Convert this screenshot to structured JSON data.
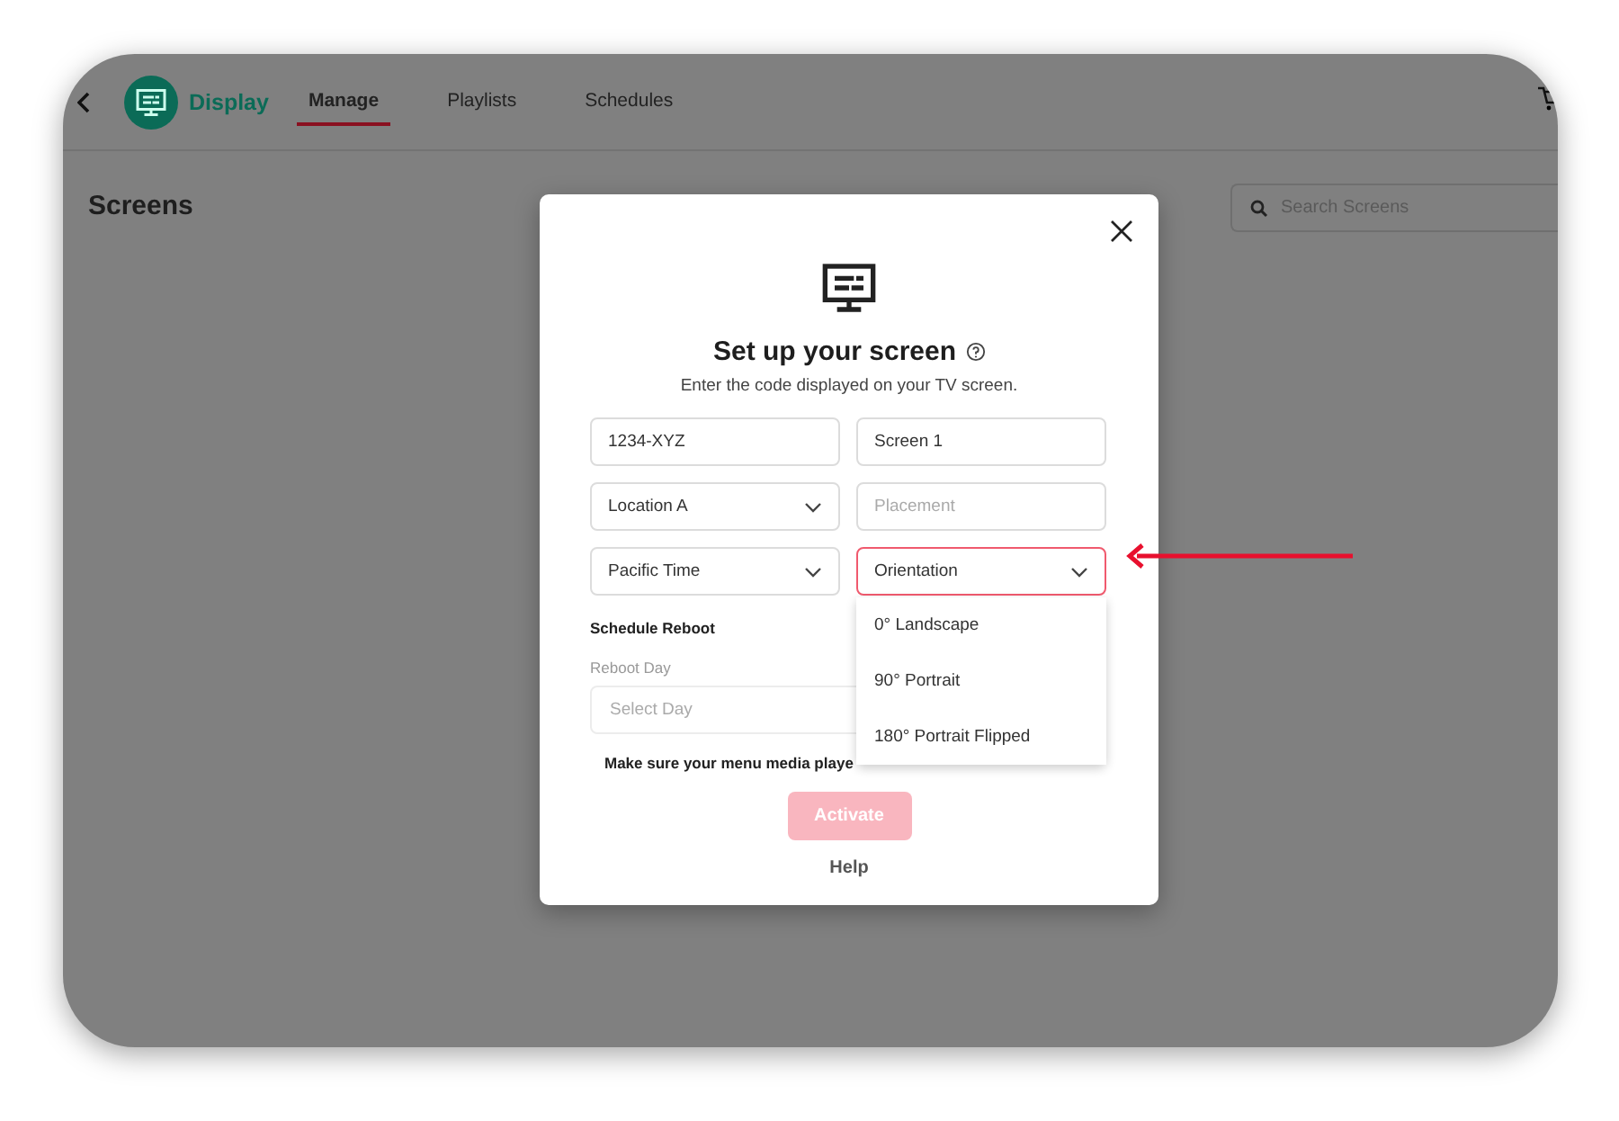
{
  "app_bar": {
    "brand": "Display",
    "tabs": [
      {
        "label": "Manage",
        "selected": true
      },
      {
        "label": "Playlists",
        "selected": false
      },
      {
        "label": "Schedules",
        "selected": false
      }
    ]
  },
  "page": {
    "title": "Screens",
    "search": {
      "placeholder": "Search Screens"
    }
  },
  "dialog": {
    "title": "Set up your screen",
    "subtitle": "Enter the code displayed on your TV screen.",
    "fields": [
      {
        "kind": "text",
        "value": "1234-XYZ"
      },
      {
        "kind": "text",
        "value": "Screen 1"
      },
      {
        "kind": "select",
        "value": "Location A",
        "open": false
      },
      {
        "kind": "text",
        "placeholder": "Placement"
      },
      {
        "kind": "select",
        "value": "Pacific Time",
        "open": false
      },
      {
        "kind": "select",
        "value": "Orientation",
        "open": true
      }
    ],
    "orientation_options": [
      "0° Landscape",
      "90° Portrait",
      "180° Portrait Flipped"
    ],
    "section_title": "Schedule Reboot",
    "reboot_label": "Reboot Day",
    "reboot_select": {
      "placeholder": "Select Day"
    },
    "notice": "Make sure your menu media playe",
    "activate": {
      "label": "Activate",
      "disabled": true
    },
    "help": "Help"
  }
}
